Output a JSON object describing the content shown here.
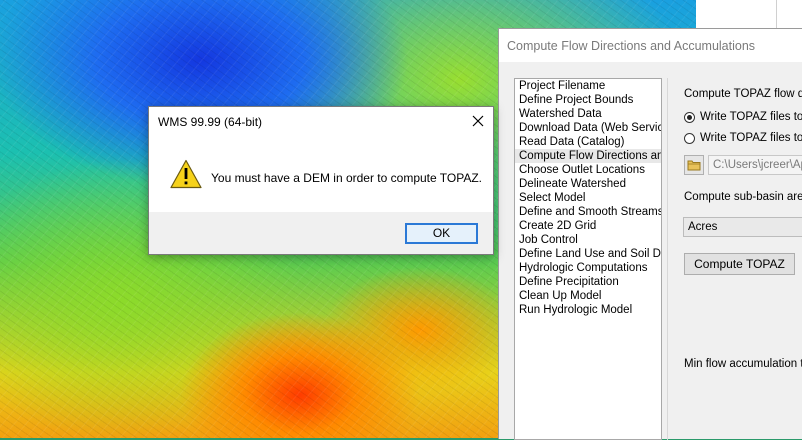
{
  "compute_dialog": {
    "title": "Compute Flow Directions and Accumulations",
    "steps": [
      {
        "label": "Project Filename"
      },
      {
        "label": "Define Project Bounds"
      },
      {
        "label": "Watershed Data"
      },
      {
        "label": "Download Data (Web Service"
      },
      {
        "label": "Read Data (Catalog)"
      },
      {
        "label": "Compute Flow Directions and",
        "selected": true
      },
      {
        "label": "Choose Outlet Locations"
      },
      {
        "label": "Delineate Watershed"
      },
      {
        "label": "Select Model"
      },
      {
        "label": "Define and Smooth Streams"
      },
      {
        "label": "Create 2D Grid"
      },
      {
        "label": "Job Control"
      },
      {
        "label": "Define Land Use and Soil Dat"
      },
      {
        "label": "Hydrologic Computations"
      },
      {
        "label": "Define Precipitation"
      },
      {
        "label": "Clean Up Model"
      },
      {
        "label": "Run Hydrologic Model"
      }
    ],
    "options": {
      "heading": "Compute TOPAZ flow dat",
      "radio1": "Write TOPAZ files to a",
      "radio2": "Write TOPAZ files to a",
      "path": "C:\\Users\\jcreer\\Ap",
      "subbasin_label": "Compute sub-basin areas",
      "units": "Acres",
      "compute_button": "Compute TOPAZ",
      "min_flow_label": "Min flow accumulation thr"
    }
  },
  "message_box": {
    "title": "WMS 99.99 (64-bit)",
    "message": "You must have a DEM in order to compute TOPAZ.",
    "ok": "OK",
    "icon": "warning-icon",
    "close_icon": "close-icon"
  }
}
